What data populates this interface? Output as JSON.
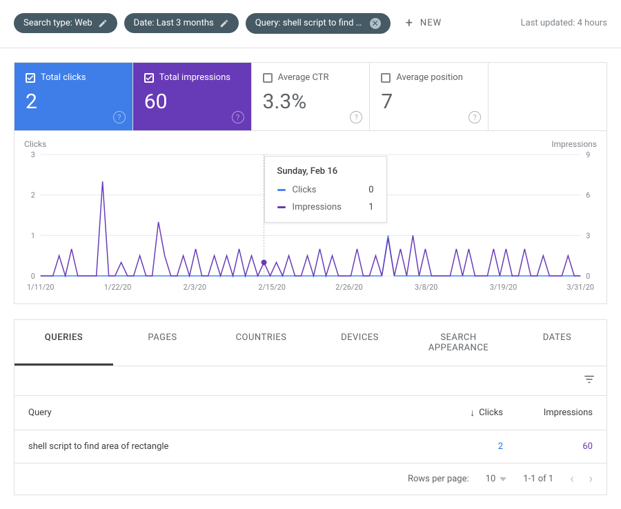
{
  "filters": {
    "chips": [
      {
        "label": "Search type: Web",
        "icon": "edit"
      },
      {
        "label": "Date: Last 3 months",
        "icon": "edit"
      },
      {
        "label": "Query: shell script to find area of …",
        "icon": "close"
      }
    ],
    "new_label": "NEW"
  },
  "last_updated": "Last updated: 4 hours",
  "metrics": {
    "clicks": {
      "label": "Total clicks",
      "value": "2",
      "checked": true
    },
    "impressions": {
      "label": "Total impressions",
      "value": "60",
      "checked": true
    },
    "ctr": {
      "label": "Average CTR",
      "value": "3.3%",
      "checked": false
    },
    "position": {
      "label": "Average position",
      "value": "7",
      "checked": false
    }
  },
  "chart_data": {
    "type": "line",
    "left_axis_label": "Clicks",
    "right_axis_label": "Impressions",
    "left_ticks": [
      0,
      1,
      2,
      3
    ],
    "right_ticks": [
      0,
      3,
      6,
      9
    ],
    "x_labels": [
      "1/11/20",
      "1/22/20",
      "2/3/20",
      "2/15/20",
      "2/26/20",
      "3/8/20",
      "3/19/20",
      "3/31/20"
    ],
    "series": [
      {
        "name": "Clicks",
        "color": "#4285f4",
        "axis": "left",
        "values": [
          0,
          0,
          0,
          0,
          0,
          0,
          0,
          0,
          0,
          0,
          0,
          0,
          0,
          0,
          0,
          0,
          0,
          0,
          0,
          0,
          0,
          0,
          0,
          0,
          0,
          0,
          0,
          0,
          0,
          0,
          0,
          0,
          0,
          0,
          0,
          0,
          0,
          0,
          0,
          0,
          0,
          0,
          0,
          0,
          0,
          0,
          0,
          0,
          0,
          0,
          0,
          0,
          0,
          0,
          0,
          0,
          1,
          0,
          0,
          0,
          0,
          0,
          0,
          0,
          0,
          0,
          0,
          0,
          0,
          0,
          0,
          0,
          0,
          0,
          0,
          0,
          0,
          0,
          0,
          0,
          0,
          0,
          0,
          0,
          0,
          0,
          0,
          0
        ]
      },
      {
        "name": "Impressions",
        "color": "#673ab7",
        "axis": "right",
        "values": [
          0,
          0,
          0,
          1.5,
          0,
          2,
          0,
          0,
          0,
          0,
          7,
          0,
          0,
          1,
          0,
          0,
          1.5,
          0,
          0,
          4,
          1.5,
          0,
          0,
          1.5,
          0,
          2,
          0,
          0,
          1.5,
          0,
          1.5,
          0,
          2,
          0,
          1.5,
          0,
          1,
          0,
          1,
          0,
          1.5,
          0,
          0,
          1.5,
          0,
          2,
          0,
          1.5,
          0,
          0,
          0,
          2,
          0,
          0,
          1.5,
          0,
          2.8,
          0,
          2,
          0,
          3,
          0,
          2,
          0,
          0,
          0,
          0,
          2,
          0,
          2,
          0,
          0,
          0,
          2,
          0,
          2,
          0,
          0,
          2,
          0,
          0,
          1.5,
          0,
          0,
          0,
          1.5,
          0,
          0
        ]
      }
    ],
    "tooltip": {
      "date": "Sunday, Feb 16",
      "clicks_label": "Clicks",
      "clicks_value": "0",
      "impressions_label": "Impressions",
      "impressions_value": "1",
      "x_index": 36
    }
  },
  "tabs": [
    "QUERIES",
    "PAGES",
    "COUNTRIES",
    "DEVICES",
    "SEARCH APPEARANCE",
    "DATES"
  ],
  "active_tab": 0,
  "table": {
    "header": {
      "query": "Query",
      "clicks": "Clicks",
      "impressions": "Impressions"
    },
    "rows": [
      {
        "query": "shell script to find area of rectangle",
        "clicks": "2",
        "impressions": "60"
      }
    ]
  },
  "pager": {
    "rows_label": "Rows per page:",
    "rows_value": "10",
    "range": "1-1 of 1"
  }
}
